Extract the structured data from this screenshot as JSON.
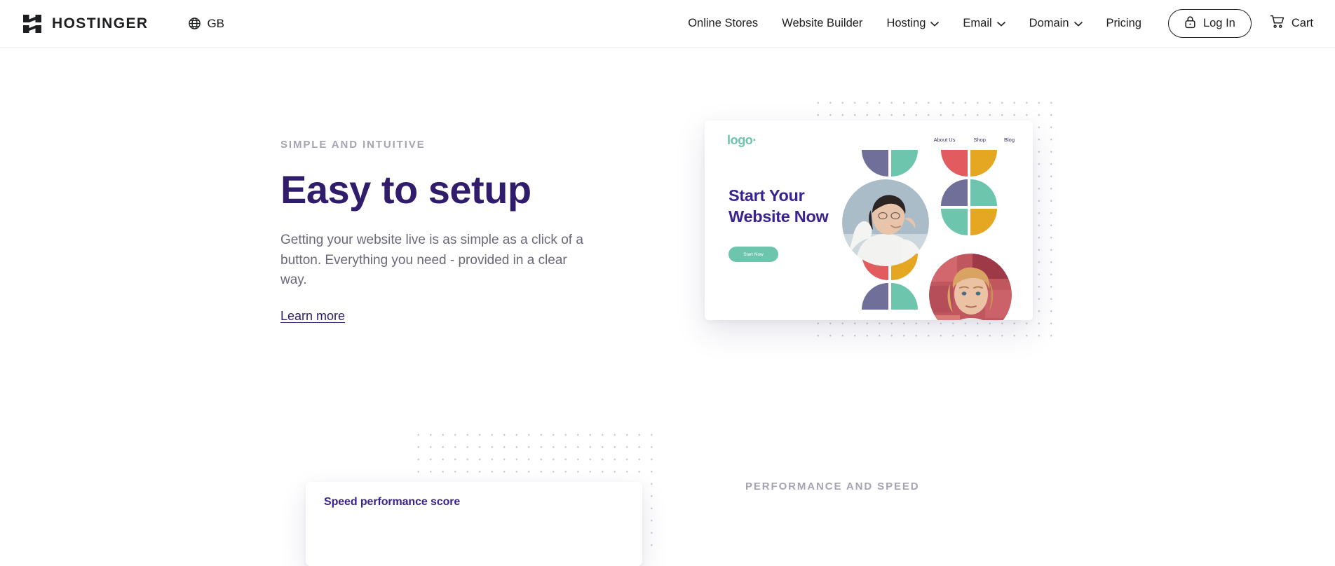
{
  "header": {
    "brand_name": "HOSTINGER",
    "logo_icon": "hostinger-h-logo",
    "locale": {
      "icon": "globe-icon",
      "label": "GB"
    },
    "nav_items": [
      {
        "label": "Online Stores",
        "has_dropdown": false
      },
      {
        "label": "Website Builder",
        "has_dropdown": false
      },
      {
        "label": "Hosting",
        "has_dropdown": true
      },
      {
        "label": "Email",
        "has_dropdown": true
      },
      {
        "label": "Domain",
        "has_dropdown": true
      },
      {
        "label": "Pricing",
        "has_dropdown": false
      }
    ],
    "login": {
      "label": "Log In",
      "icon": "lock-icon"
    },
    "cart": {
      "label": "Cart",
      "icon": "shopping-cart-icon"
    }
  },
  "section_easy_setup": {
    "eyebrow": "SIMPLE AND INTUITIVE",
    "heading": "Easy to setup",
    "body": "Getting your website live is as simple as a click of a button. Everything you need - provided in a clear way.",
    "link_label": "Learn more"
  },
  "preview_card": {
    "logo": "logo·",
    "nav": [
      "About Us",
      "Shop",
      "Blog"
    ],
    "heading_line1": "Start Your",
    "heading_line2": "Website Now",
    "cta_label": "Start Now",
    "photo_alt_1": "woman-smiling-portrait",
    "photo_alt_2": "young-man-portrait"
  },
  "section_performance": {
    "eyebrow": "PERFORMANCE AND SPEED",
    "card_title": "Speed performance score"
  },
  "colors": {
    "brand_dark": "#1d1e20",
    "heading_purple": "#2f1c6a",
    "body_gray": "#6b6879",
    "eyebrow_gray": "#a7a3b3",
    "accent_teal": "#6dc5ae",
    "accent_periwinkle": "#6f6f99",
    "accent_red": "#e25c5f",
    "accent_amber": "#e5a622",
    "preview_heading": "#3a2290",
    "dot_gray": "#c8c6d2"
  }
}
